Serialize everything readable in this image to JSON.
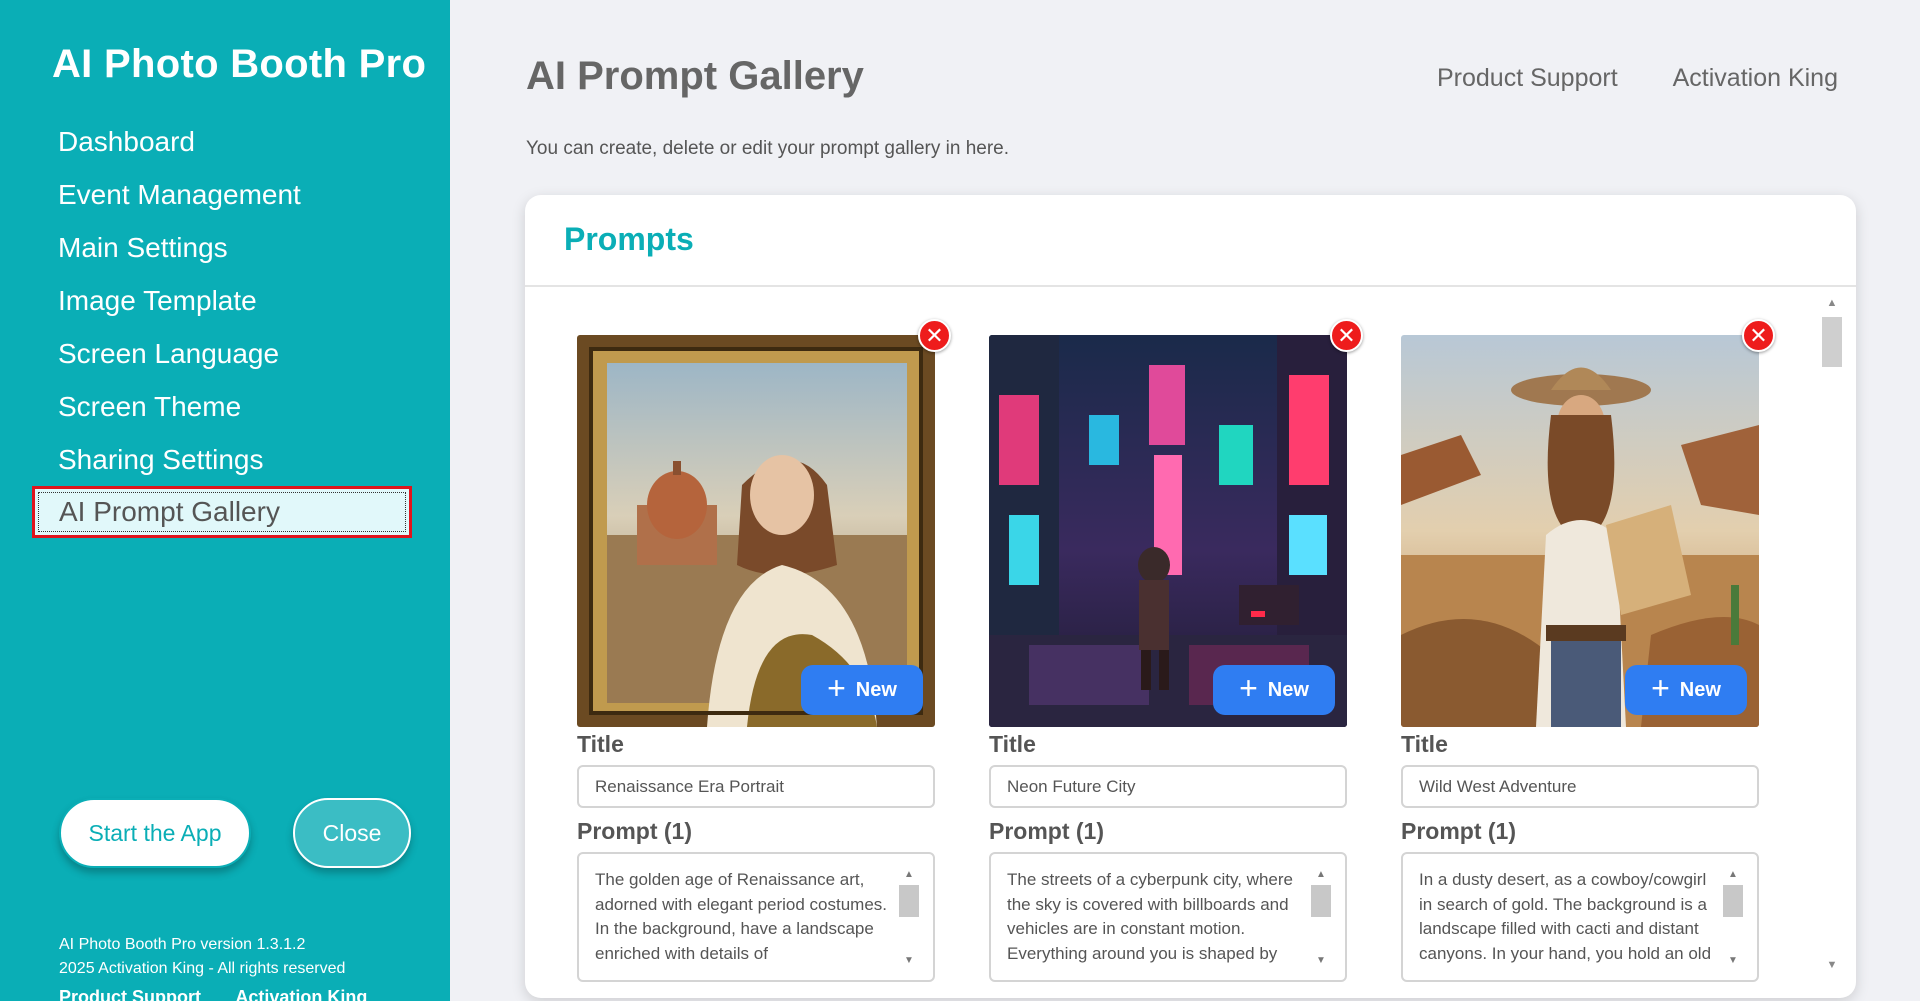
{
  "sidebar": {
    "app_title": "AI Photo Booth Pro",
    "items": [
      {
        "label": "Dashboard"
      },
      {
        "label": "Event Management"
      },
      {
        "label": "Main Settings"
      },
      {
        "label": "Image Template"
      },
      {
        "label": "Screen Language"
      },
      {
        "label": "Screen Theme"
      },
      {
        "label": "Sharing Settings"
      },
      {
        "label": "AI Prompt Gallery"
      }
    ],
    "active_item": "AI Prompt Gallery",
    "start_button": "Start the App",
    "close_button": "Close",
    "footer_version": "AI Photo Booth Pro version 1.3.1.2",
    "footer_copyright": "2025 Activation King - All rights reserved",
    "footer_link_support": "Product Support",
    "footer_link_company": "Activation King"
  },
  "header": {
    "title": "AI Prompt Gallery",
    "link_support": "Product Support",
    "link_company": "Activation King",
    "subtitle": "You can create, delete or edit your prompt gallery in here."
  },
  "card": {
    "title": "Prompts",
    "title_label": "Title",
    "prompt_label": "Prompt (1)",
    "new_label": "New",
    "delete_icon": "close-icon",
    "prompts": [
      {
        "image": "renaissance-portrait-image",
        "title": "Renaissance Era Portrait",
        "prompt": "The golden age of Renaissance art, adorned with elegant period costumes. In the background, have a landscape enriched with details of"
      },
      {
        "image": "cyberpunk-city-image",
        "title": "Neon Future City",
        "prompt": "The streets of a cyberpunk city, where the sky is covered with billboards and vehicles are in constant motion. Everything around you is shaped by"
      },
      {
        "image": "cowgirl-desert-image",
        "title": "Wild West Adventure",
        "prompt": "In a dusty desert, as a cowboy/cowgirl in search of gold. The background is a landscape filled with cacti and distant canyons. In your hand, you hold an old"
      }
    ]
  },
  "colors": {
    "sidebar_bg": "#0aaeb6",
    "accent": "#0aaeb6",
    "new_button": "#2f7df2",
    "delete_button": "#ee1c1c",
    "active_outline": "#e0141c"
  }
}
